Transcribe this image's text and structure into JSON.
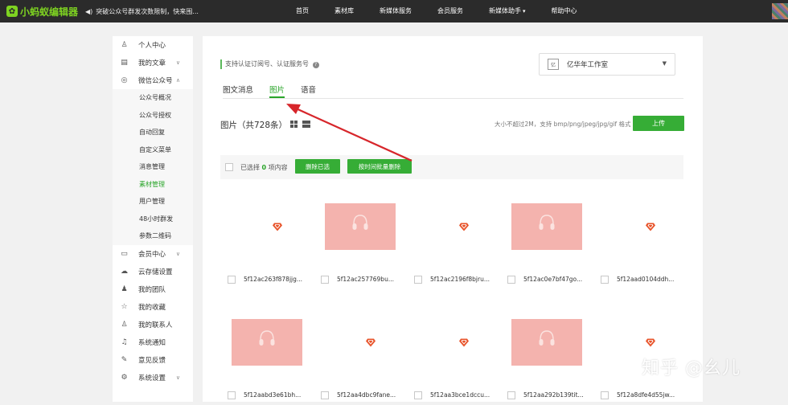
{
  "topbar": {
    "logo": "小蚂蚁编辑器",
    "notice": "突破公众号群发次数限制，快来围...",
    "nav": [
      {
        "label": "首页",
        "has_caret": false
      },
      {
        "label": "素材库",
        "has_caret": false
      },
      {
        "label": "新媒体服务",
        "has_caret": false
      },
      {
        "label": "会员服务",
        "has_caret": false
      },
      {
        "label": "新媒体助手",
        "has_caret": true
      },
      {
        "label": "帮助中心",
        "has_caret": false
      }
    ]
  },
  "sidebar": {
    "top_items": [
      {
        "label": "个人中心",
        "icon": "user-icon",
        "glyph": "♙"
      },
      {
        "label": "我的文章",
        "icon": "document-icon",
        "glyph": "▤"
      },
      {
        "label": "微信公众号",
        "icon": "wechat-icon",
        "glyph": "◎"
      }
    ],
    "sub_items": [
      {
        "label": "公众号概况",
        "active": false
      },
      {
        "label": "公众号授权",
        "active": false
      },
      {
        "label": "自动回复",
        "active": false
      },
      {
        "label": "自定义菜单",
        "active": false
      },
      {
        "label": "消息管理",
        "active": false
      },
      {
        "label": "素材管理",
        "active": true
      },
      {
        "label": "用户管理",
        "active": false
      },
      {
        "label": "48小时群发",
        "active": false
      },
      {
        "label": "参数二维码",
        "active": false
      }
    ],
    "bottom_items": [
      {
        "label": "会员中心",
        "icon": "card-icon",
        "glyph": "▭",
        "chevron": true
      },
      {
        "label": "云存储设置",
        "icon": "cloud-icon",
        "glyph": "☁",
        "chevron": false
      },
      {
        "label": "我的团队",
        "icon": "team-icon",
        "glyph": "♟",
        "chevron": false
      },
      {
        "label": "我的收藏",
        "icon": "star-icon",
        "glyph": "☆",
        "chevron": false
      },
      {
        "label": "我的联系人",
        "icon": "add-contact-icon",
        "glyph": "♙",
        "chevron": false
      },
      {
        "label": "系统通知",
        "icon": "bell-icon",
        "glyph": "♫",
        "chevron": false
      },
      {
        "label": "意见反馈",
        "icon": "edit-icon",
        "glyph": "✎",
        "chevron": false
      },
      {
        "label": "系统设置",
        "icon": "gear-icon",
        "glyph": "⚙",
        "chevron": true
      }
    ]
  },
  "main": {
    "auth_hint": "支持认证订阅号、认证服务号",
    "account": {
      "name": "亿华年工作室",
      "logo_text": "亿"
    },
    "tabs": [
      {
        "label": "图文消息",
        "active": false
      },
      {
        "label": "图片",
        "active": true
      },
      {
        "label": "语音",
        "active": false
      }
    ],
    "count_title": "图片（共728条）",
    "upload_hint": "大小不超过2M，支持 bmp/png/jpeg/jpg/gif 格式",
    "upload_label": "上传",
    "selected_prefix": "已选择",
    "selected_count": "0",
    "selected_suffix": "项内容",
    "delete_selected_label": "删除已选",
    "batch_delete_label": "按时间批量删除",
    "images": [
      {
        "name": "5f12ac263f878jjg...",
        "kind": "gem"
      },
      {
        "name": "5f12ac257769bu...",
        "kind": "photo"
      },
      {
        "name": "5f12ac2196f8bjru...",
        "kind": "gem"
      },
      {
        "name": "5f12ac0e7bf47go...",
        "kind": "photo"
      },
      {
        "name": "5f12aad0104ddh...",
        "kind": "gem"
      },
      {
        "name": "5f12aabd3e61bh...",
        "kind": "photo"
      },
      {
        "name": "5f12aa4dbc9fane...",
        "kind": "gem"
      },
      {
        "name": "5f12aa3bce1dccu...",
        "kind": "gem"
      },
      {
        "name": "5f12aa292b139tit...",
        "kind": "photo"
      },
      {
        "name": "5f12a8dfe4d55jw...",
        "kind": "gem"
      }
    ]
  },
  "colors": {
    "accent": "#36ad36",
    "topbar": "#2b2b2b",
    "gem": "#e8542b",
    "photo": "#f4b3ae",
    "arrow": "#d7262b"
  },
  "watermark": "知乎 @幺儿"
}
